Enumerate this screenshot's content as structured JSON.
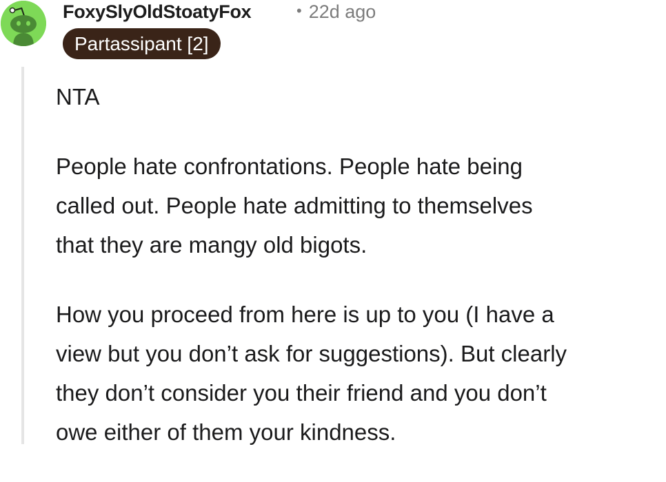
{
  "comment": {
    "author": "FoxySlyOldStoatyFox",
    "separator": "•",
    "age": "22d ago",
    "flair": "Partassipant [2]",
    "avatar_icon": "snoo-avatar-icon",
    "paragraphs": [
      "NTA",
      "People hate confrontations. People hate being\ncalled out. People hate admitting to themselves\nthat they are mangy old bigots.",
      "How you proceed from here is up to you (I have a\nview but you don’t ask for suggestions). But clearly\nthey don’t consider you their friend and you don’t\nowe either of them your kindness."
    ]
  },
  "colors": {
    "avatar_bg": "#7ed957",
    "flair_bg": "#3a2418",
    "meta_text": "#7c7c7c",
    "thread_line": "#e5e5e5"
  }
}
